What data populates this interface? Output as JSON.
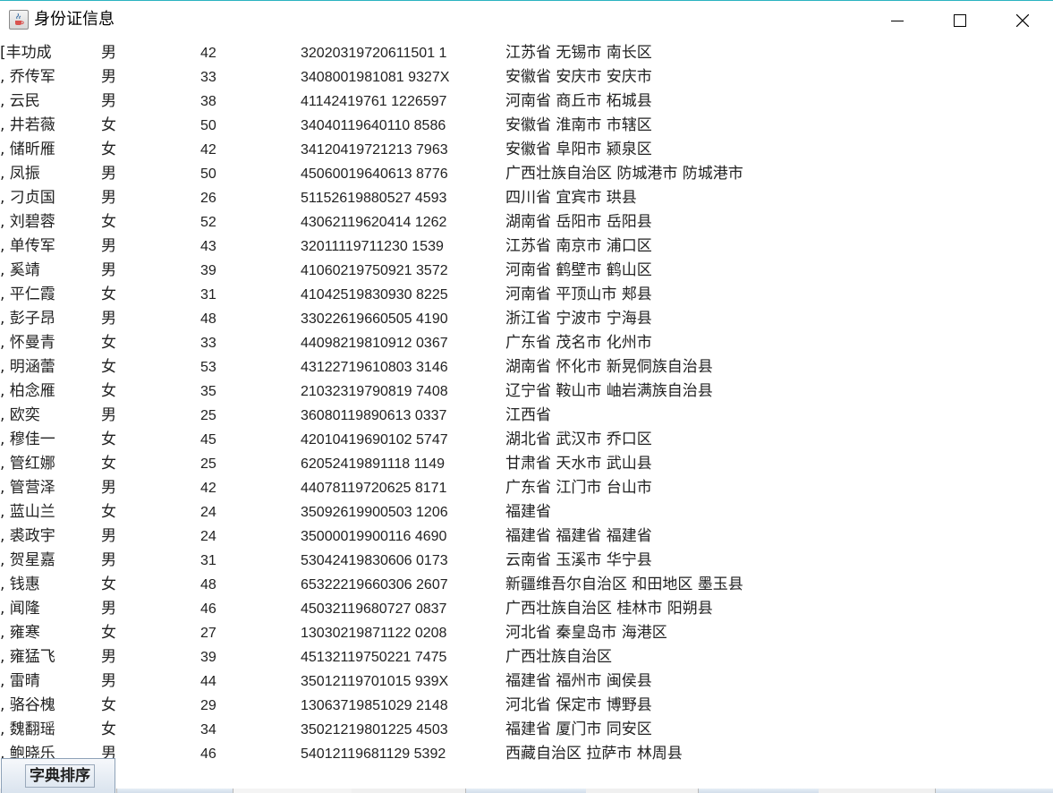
{
  "window": {
    "title": "身份证信息",
    "icon": "java-cup-icon"
  },
  "controls": {
    "minimize_icon": "minimize-icon",
    "maximize_icon": "maximize-icon",
    "close_icon": "close-icon"
  },
  "rows": [
    {
      "name": "[丰功成",
      "sex": "男",
      "age": "42",
      "id": "32020319720611501 1",
      "address": "江苏省 无锡市 南长区"
    },
    {
      "name": ", 乔传军",
      "sex": "男",
      "age": "33",
      "id": "3408001981081 9327X",
      "address": "安徽省 安庆市 安庆市"
    },
    {
      "name": ", 云民",
      "sex": "男",
      "age": "38",
      "id": "41142419761 1226597",
      "address": "河南省 商丘市 柘城县"
    },
    {
      "name": ", 井若薇",
      "sex": "女",
      "age": "50",
      "id": "34040119640110 8586",
      "address": "安徽省 淮南市 市辖区"
    },
    {
      "name": ", 储昕雁",
      "sex": "女",
      "age": "42",
      "id": "34120419721213 7963",
      "address": "安徽省 阜阳市 颍泉区"
    },
    {
      "name": ", 凤振",
      "sex": "男",
      "age": "50",
      "id": "45060019640613 8776",
      "address": "广西壮族自治区 防城港市 防城港市"
    },
    {
      "name": ", 刁贞国",
      "sex": "男",
      "age": "26",
      "id": "51152619880527 4593",
      "address": "四川省 宜宾市 珙县"
    },
    {
      "name": ", 刘碧蓉",
      "sex": "女",
      "age": "52",
      "id": "43062119620414 1262",
      "address": "湖南省 岳阳市 岳阳县"
    },
    {
      "name": ", 单传军",
      "sex": "男",
      "age": "43",
      "id": "32011119711230 1539",
      "address": "江苏省 南京市 浦口区"
    },
    {
      "name": ", 奚靖",
      "sex": "男",
      "age": "39",
      "id": "41060219750921 3572",
      "address": "河南省 鹤壁市 鹤山区"
    },
    {
      "name": ", 平仁霞",
      "sex": "女",
      "age": "31",
      "id": "41042519830930 8225",
      "address": "河南省 平顶山市 郏县"
    },
    {
      "name": ", 彭子昂",
      "sex": "男",
      "age": "48",
      "id": "33022619660505 4190",
      "address": "浙江省 宁波市 宁海县"
    },
    {
      "name": ", 怀曼青",
      "sex": "女",
      "age": "33",
      "id": "44098219810912 0367",
      "address": "广东省 茂名市 化州市"
    },
    {
      "name": ", 明涵蕾",
      "sex": "女",
      "age": "53",
      "id": "43122719610803 3146",
      "address": "湖南省 怀化市 新晃侗族自治县"
    },
    {
      "name": ", 柏念雁",
      "sex": "女",
      "age": "35",
      "id": "21032319790819 7408",
      "address": "辽宁省 鞍山市 岫岩满族自治县"
    },
    {
      "name": ", 欧奕",
      "sex": "男",
      "age": "25",
      "id": "36080119890613 0337",
      "address": "江西省"
    },
    {
      "name": ", 穆佳一",
      "sex": "女",
      "age": "45",
      "id": "42010419690102 5747",
      "address": "湖北省 武汉市 乔口区"
    },
    {
      "name": ", 管红娜",
      "sex": "女",
      "age": "25",
      "id": "62052419891118 1149",
      "address": "甘肃省 天水市 武山县"
    },
    {
      "name": ", 管营泽",
      "sex": "男",
      "age": "42",
      "id": "44078119720625 8171",
      "address": "广东省 江门市 台山市"
    },
    {
      "name": ", 蓝山兰",
      "sex": "女",
      "age": "24",
      "id": "35092619900503 1206",
      "address": "福建省"
    },
    {
      "name": ", 裘政宇",
      "sex": "男",
      "age": "24",
      "id": "35000019900116 4690",
      "address": "福建省 福建省 福建省"
    },
    {
      "name": ", 贺星嘉",
      "sex": "男",
      "age": "31",
      "id": "53042419830606 0173",
      "address": "云南省 玉溪市 华宁县"
    },
    {
      "name": ", 钱惠",
      "sex": "女",
      "age": "48",
      "id": "65322219660306 2607",
      "address": "新疆维吾尔自治区 和田地区 墨玉县"
    },
    {
      "name": ", 闻隆",
      "sex": "男",
      "age": "46",
      "id": "45032119680727 0837",
      "address": "广西壮族自治区 桂林市 阳朔县"
    },
    {
      "name": ", 雍寒",
      "sex": "女",
      "age": "27",
      "id": "13030219871122 0208",
      "address": "河北省 秦皇岛市 海港区"
    },
    {
      "name": ", 雍猛飞",
      "sex": "男",
      "age": "39",
      "id": "45132119750221 7475",
      "address": "广西壮族自治区"
    },
    {
      "name": ", 雷晴",
      "sex": "男",
      "age": "44",
      "id": "35012119701015 939X",
      "address": "福建省 福州市 闽侯县"
    },
    {
      "name": ", 骆谷槐",
      "sex": "女",
      "age": "29",
      "id": "13063719851029 2148",
      "address": "河北省 保定市 博野县"
    },
    {
      "name": ", 魏翻瑶",
      "sex": "女",
      "age": "34",
      "id": "35021219801225 4503",
      "address": "福建省 厦门市 同安区"
    },
    {
      "name": ", 鲍晓乐",
      "sex": "男",
      "age": "46",
      "id": "54012119681129 5392",
      "address": "西藏自治区 拉萨市 林周县"
    }
  ],
  "buttons": {
    "sort_label": "字典排序"
  }
}
